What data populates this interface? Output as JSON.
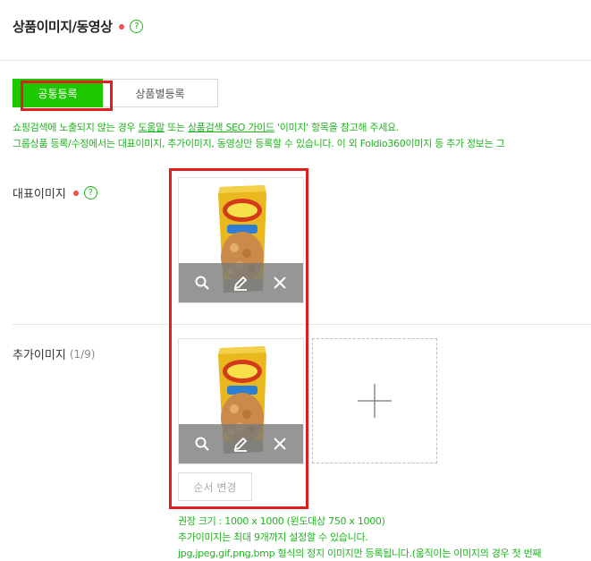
{
  "section": {
    "title": "상품이미지/동영상",
    "help_symbol": "?"
  },
  "tabs": [
    {
      "label": "공통등록",
      "active": true
    },
    {
      "label": "상품별등록",
      "active": false
    }
  ],
  "notice": {
    "line1_pre": "쇼핑검색에 노출되지 않는 경우 ",
    "line1_link1": "도움말",
    "line1_mid": " 또는 ",
    "line1_link2": "상품검색 SEO 가이드",
    "line1_post": " '이미지' 항목을 참고해 주세요.",
    "line2": "그룹상품 등록/수정에서는 대표이미지, 추가이미지, 동영상만 등록할 수 있습니다. 이 외 Foldio360이미지 등 추가 정보는 그"
  },
  "main_image": {
    "label": "대표이미지",
    "help_symbol": "?"
  },
  "additional_images": {
    "label": "추가이미지",
    "count": "(1/9)"
  },
  "order_button": {
    "label": "순서 변경"
  },
  "hints": [
    "권장 크기 : 1000 x 1000 (윈도대상 750 x 1000)",
    "추가이미지는 최대 9개까지 설정할 수 있습니다.",
    "jpg,jpeg,gif,png,bmp 형식의 정지 이미지만 등록됩니다.(움직이는 이미지의 경우 첫 번째"
  ],
  "colors": {
    "accent": "#1ec800",
    "notice_green": "#1fb41f",
    "required": "#f0504e",
    "highlight_red": "#e11e1e"
  }
}
